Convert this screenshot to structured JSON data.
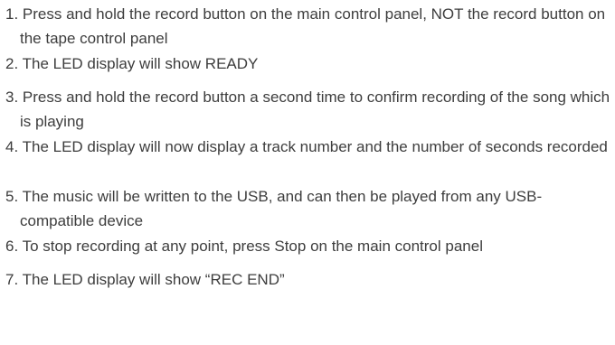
{
  "steps": [
    {
      "number": "1.",
      "text": "Press and hold the record button on the main control panel, NOT the record button on the tape control panel"
    },
    {
      "number": "2.",
      "text": "The LED display will show READY"
    },
    {
      "number": "3.",
      "text": "Press and hold the record button a second time to confirm recording of the song which is playing"
    },
    {
      "number": "4.",
      "text": "The LED display will now display a track number and the number of seconds recorded"
    },
    {
      "number": "5.",
      "text": "The music will be written to the USB, and can then be played from any USB-compatible device"
    },
    {
      "number": "6.",
      "text": "To stop recording at any point, press Stop on the main control panel"
    },
    {
      "number": "7.",
      "text": "The LED display will show “REC END”"
    }
  ]
}
